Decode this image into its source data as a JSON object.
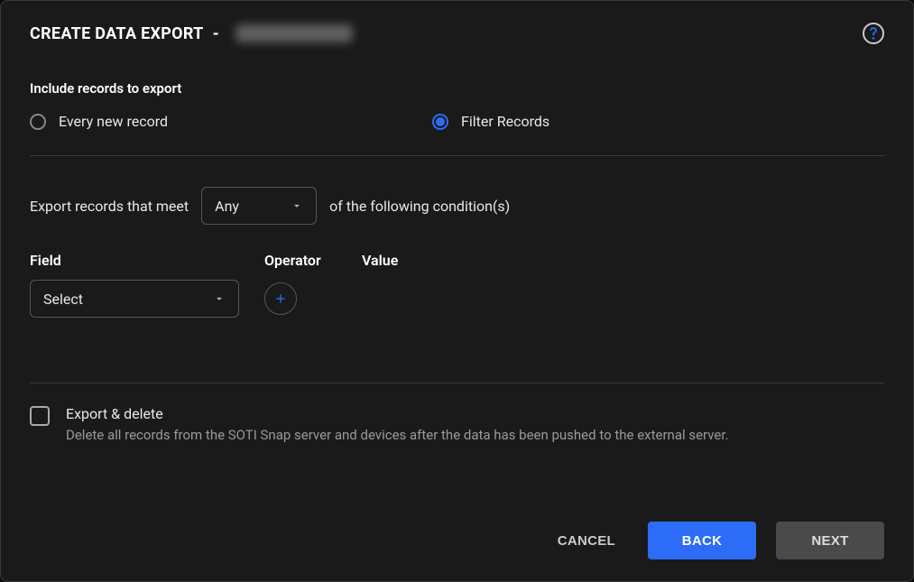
{
  "header": {
    "title": "CREATE DATA EXPORT",
    "dash": " - "
  },
  "include": {
    "label": "Include records to export",
    "options": {
      "every": "Every new record",
      "filter": "Filter Records"
    },
    "selected": "filter"
  },
  "conditions": {
    "prefix": "Export records that meet",
    "match_mode": "Any",
    "suffix": "of the following condition(s)",
    "columns": {
      "field": "Field",
      "operator": "Operator",
      "value": "Value"
    },
    "field_select_placeholder": "Select"
  },
  "export_delete": {
    "title": "Export & delete",
    "description": "Delete all records from the SOTI Snap server and devices after the data has been pushed to the external server.",
    "checked": false
  },
  "footer": {
    "cancel": "CANCEL",
    "back": "BACK",
    "next": "NEXT"
  }
}
